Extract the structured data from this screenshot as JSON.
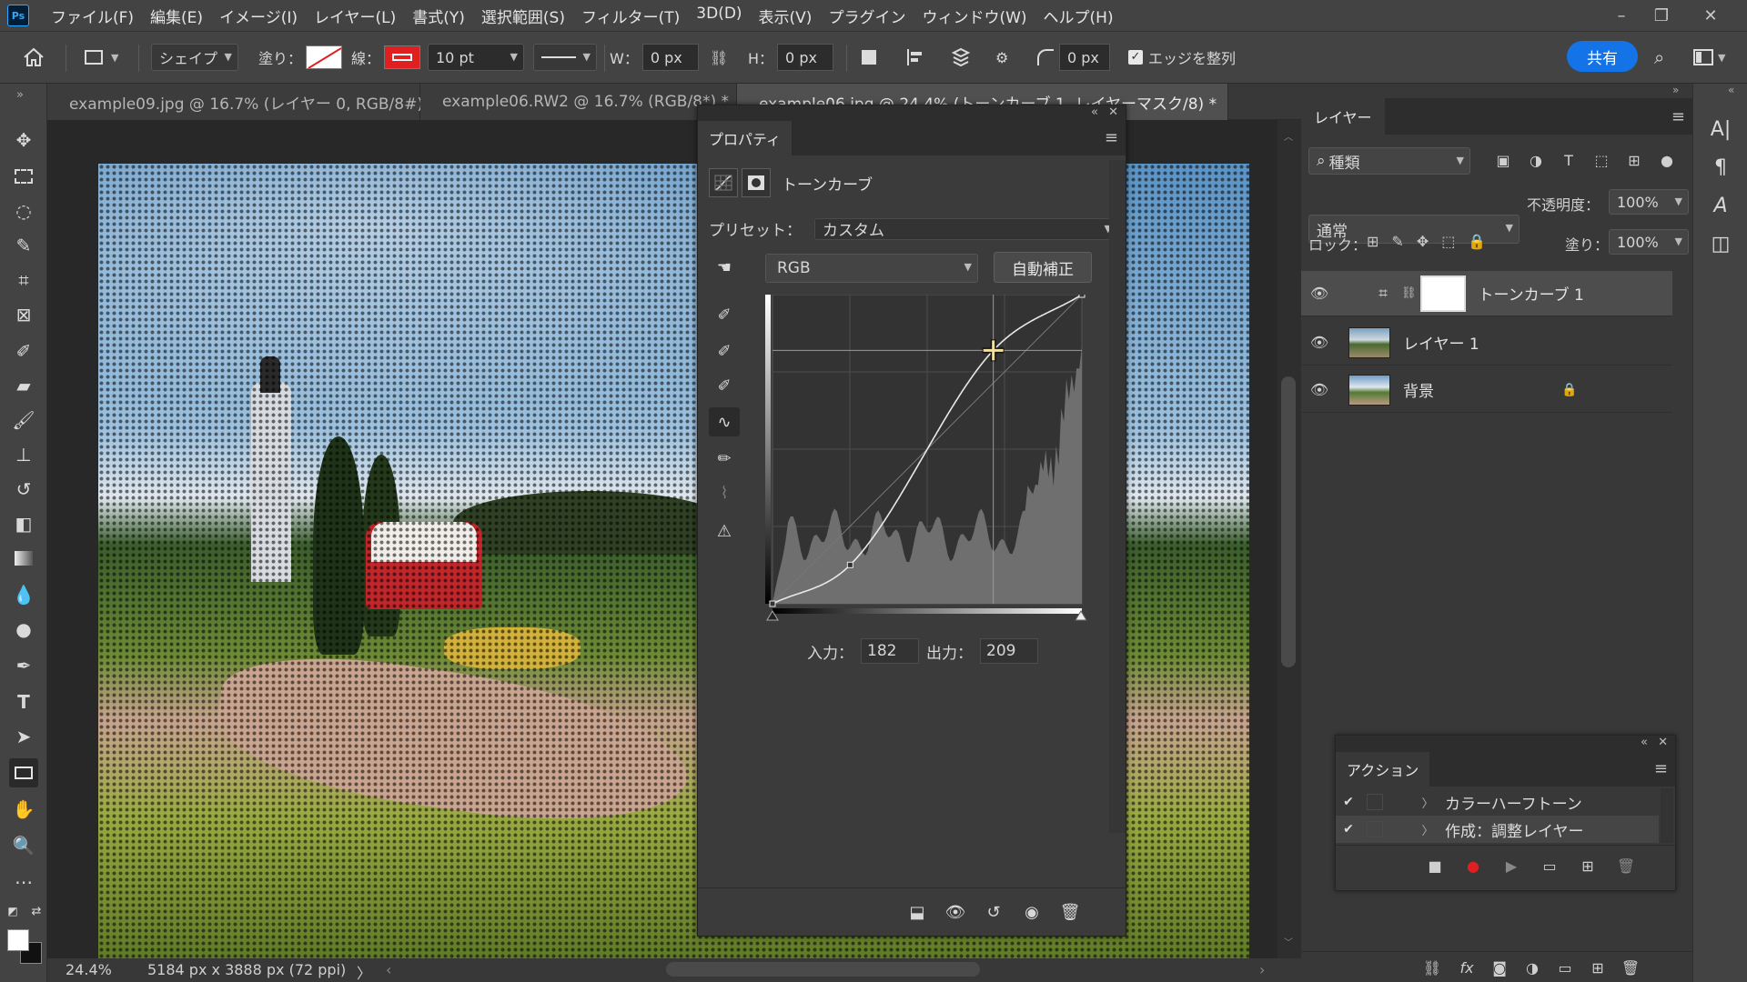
{
  "app": {
    "logo": "Ps"
  },
  "menu": [
    "ファイル(F)",
    "編集(E)",
    "イメージ(I)",
    "レイヤー(L)",
    "書式(Y)",
    "選択範囲(S)",
    "フィルター(T)",
    "3D(D)",
    "表示(V)",
    "プラグイン",
    "ウィンドウ(W)",
    "ヘルプ(H)"
  ],
  "options": {
    "shape_mode": "シェイプ",
    "fill_label": "塗り：",
    "stroke_label": "線：",
    "stroke_size": "10 pt",
    "w_label": "W：",
    "w_value": "0 px",
    "h_label": "H：",
    "h_value": "0 px",
    "radius_value": "0 px",
    "align_edges_label": "エッジを整列",
    "share_label": "共有",
    "stroke_color": "#e02020"
  },
  "tabs": [
    {
      "label": "example09.jpg @ 16.7% (レイヤー 0, RGB/8#) *",
      "close": "✕"
    },
    {
      "label": "example06.RW2 @ 16.7% (RGB/8*) *",
      "close": "✕"
    },
    {
      "label": "example06.jpg @ 24.4% (トーンカーブ 1, レイヤーマスク/8) *",
      "close": "✕"
    }
  ],
  "status": {
    "zoom": "24.4%",
    "doc_info": "5184 px x 3888 px (72 ppi)",
    "arrow": "〉"
  },
  "properties": {
    "title": "プロパティ",
    "adjustment_name": "トーンカーブ",
    "preset_label": "プリセット：",
    "preset_value": "カスタム",
    "channel": "RGB",
    "auto_label": "自動補正",
    "input_label": "入力：",
    "input_value": "182",
    "output_label": "出力：",
    "output_value": "209"
  },
  "curve": {
    "channel": "RGB",
    "input_range": [
      0,
      255
    ],
    "output_range": [
      0,
      255
    ],
    "points": [
      [
        0,
        0
      ],
      [
        64,
        32
      ],
      [
        182,
        209
      ],
      [
        255,
        255
      ]
    ],
    "selected_point": [
      182,
      209
    ]
  },
  "layers": {
    "title": "レイヤー",
    "kind_label": "種類",
    "blend_mode": "通常",
    "opacity_label": "不透明度：",
    "opacity_value": "100%",
    "lock_label": "ロック：",
    "fill_label": "塗り：",
    "fill_value": "100%",
    "items": [
      {
        "name": "トーンカーブ 1",
        "selected": true
      },
      {
        "name": "レイヤー 1",
        "selected": false
      },
      {
        "name": "背景",
        "selected": false,
        "locked": true
      }
    ]
  },
  "actions": {
    "title": "アクション",
    "items": [
      {
        "name": "カラーハーフトーン",
        "checked": true
      },
      {
        "name": "作成：調整レイヤー",
        "checked": true
      }
    ],
    "record_color": "#e02020"
  },
  "colors": {
    "accent": "#1473e6",
    "panel_bg": "#383838",
    "bar_bg": "#434343"
  }
}
